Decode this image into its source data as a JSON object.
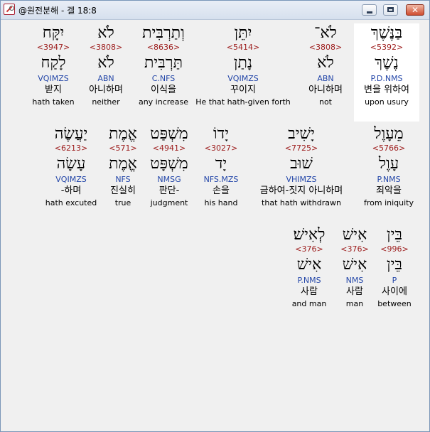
{
  "window": {
    "title": "@원전분해 - 겔 18:8"
  },
  "verse": {
    "rows": [
      {
        "words": [
          {
            "surface": "בַּנֶּשֶׁךְ",
            "strong": "<5392>",
            "lemma": "נֶשֶׁךְ",
            "parsing": "P.D.NMS",
            "korean": "변을 위하여",
            "english": "upon usury",
            "selected": true
          },
          {
            "surface": "לֹא־",
            "strong": "<3808>",
            "lemma": "לֹא",
            "parsing": "ABN",
            "korean": "아니하며",
            "english": "not"
          },
          {
            "surface": "יִתֵּן",
            "strong": "<5414>",
            "lemma": "נָתַן",
            "parsing": "VQIMZS",
            "korean": "꾸이지",
            "english": "He that hath-given forth"
          },
          {
            "surface": "וְתַרְבִּית",
            "strong": "<8636>",
            "lemma": "תַּרְבִּית",
            "parsing": "C.NFS",
            "korean": "이식을",
            "english": "any increase"
          },
          {
            "surface": "לֹא",
            "strong": "<3808>",
            "lemma": "לֹא",
            "parsing": "ABN",
            "korean": "아니하며",
            "english": "neither"
          },
          {
            "surface": "יִקָּח",
            "strong": "<3947>",
            "lemma": "לָקַח",
            "parsing": "VQIMZS",
            "korean": "받지",
            "english": "hath taken"
          }
        ]
      },
      {
        "words": [
          {
            "surface": "מֵעָוֶל",
            "strong": "<5766>",
            "lemma": "עָוֶל",
            "parsing": "P.NMS",
            "korean": "죄악을",
            "english": "from iniquity"
          },
          {
            "surface": "יָשִׁיב",
            "strong": "<7725>",
            "lemma": "שׁוּב",
            "parsing": "VHIMZS",
            "korean": "금하여-짓지 아니하며",
            "english": "that hath withdrawn"
          },
          {
            "surface": "יָדוֹ",
            "strong": "<3027>",
            "lemma": "יָד",
            "parsing": "NFS.MZS",
            "korean": "손을",
            "english": "his hand"
          },
          {
            "surface": "מִשְׁפַּט",
            "strong": "<4941>",
            "lemma": "מִשְׁפָּט",
            "parsing": "NMSG",
            "korean": "판단-",
            "english": "judgment"
          },
          {
            "surface": "אֱמֶת",
            "strong": "<571>",
            "lemma": "אֱמֶת",
            "parsing": "NFS",
            "korean": "진실히",
            "english": "true"
          },
          {
            "surface": "יַעֲשֶׂה",
            "strong": "<6213>",
            "lemma": "עָשָׂה",
            "parsing": "VQIMZS",
            "korean": "-하며",
            "english": "hath excuted"
          }
        ]
      },
      {
        "words": [
          {
            "surface": "בֵּין",
            "strong": "<996>",
            "lemma": "בֵּין",
            "parsing": "P",
            "korean": "사이에",
            "english": "between"
          },
          {
            "surface": "אִישׁ",
            "strong": "<376>",
            "lemma": "אִישׁ",
            "parsing": "NMS",
            "korean": "사람",
            "english": "man"
          },
          {
            "surface": "לְאִישׁ׃",
            "strong": "<376>",
            "lemma": "אִישׁ",
            "parsing": "P.NMS",
            "korean": "사람",
            "english": "and man"
          }
        ]
      }
    ]
  }
}
